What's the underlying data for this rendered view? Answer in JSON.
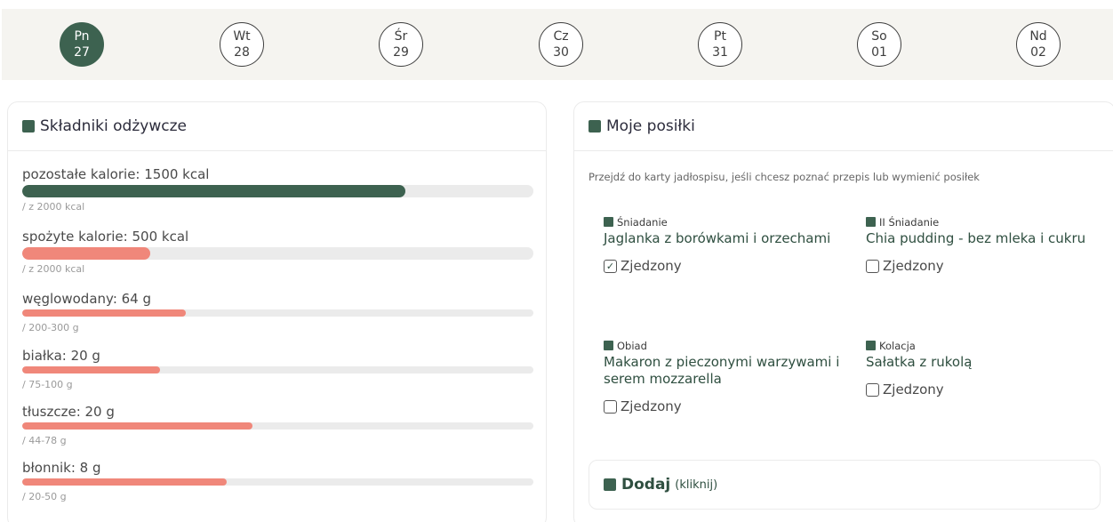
{
  "week": [
    {
      "day": "Pn",
      "date": "27",
      "active": true
    },
    {
      "day": "Wt",
      "date": "28",
      "active": false
    },
    {
      "day": "Śr",
      "date": "29",
      "active": false
    },
    {
      "day": "Cz",
      "date": "30",
      "active": false
    },
    {
      "day": "Pt",
      "date": "31",
      "active": false
    },
    {
      "day": "So",
      "date": "01",
      "active": false
    },
    {
      "day": "Nd",
      "date": "02",
      "active": false
    }
  ],
  "nutrients_panel": {
    "title": "Składniki odżywcze",
    "items": [
      {
        "label": "pozostałe kalorie: 1500 kcal",
        "sub": "/ z 2000 kcal",
        "fraction": 0.75,
        "color": "#3d6250"
      },
      {
        "label": "spożyte kalorie: 500 kcal",
        "sub": "/ z 2000 kcal",
        "fraction": 0.25,
        "color": "#f0877a"
      },
      {
        "label": "węglowodany: 64 g",
        "sub": "/ 200-300 g",
        "fraction": 0.32,
        "color": "#f0877a"
      },
      {
        "label": "białka: 20 g",
        "sub": "/ 75-100 g",
        "fraction": 0.27,
        "color": "#f0877a"
      },
      {
        "label": "tłuszcze: 20 g",
        "sub": "/ 44-78 g",
        "fraction": 0.45,
        "color": "#f0877a"
      },
      {
        "label": "błonnik: 8 g",
        "sub": "/ 20-50 g",
        "fraction": 0.4,
        "color": "#f0877a"
      }
    ]
  },
  "meals_panel": {
    "title": "Moje posiłki",
    "intro": "Przejdź do karty jadłospisu, jeśli chcesz poznać przepis lub wymienić posiłek",
    "meals": [
      {
        "type": "Śniadanie",
        "name": "Jaglanka z borówkami i orzechami",
        "eaten_label": "Zjedzony",
        "checked": true
      },
      {
        "type": "II Śniadanie",
        "name": "Chia pudding - bez mleka i cukru",
        "eaten_label": "Zjedzony",
        "checked": false
      },
      {
        "type": "Obiad",
        "name": "Makaron z pieczonymi warzywami i serem mozzarella",
        "eaten_label": "Zjedzony",
        "checked": false
      },
      {
        "type": "Kolacja",
        "name": "Sałatka z rukolą",
        "eaten_label": "Zjedzony",
        "checked": false
      }
    ],
    "add": {
      "label": "Dodaj",
      "hint": "(kliknij)"
    }
  },
  "colors": {
    "accent": "#3d6250",
    "salmon": "#f0877a",
    "track": "#ebebeb"
  },
  "icons": {
    "checkbox_checked": "check-icon",
    "checkbox_empty": "checkbox-icon"
  }
}
